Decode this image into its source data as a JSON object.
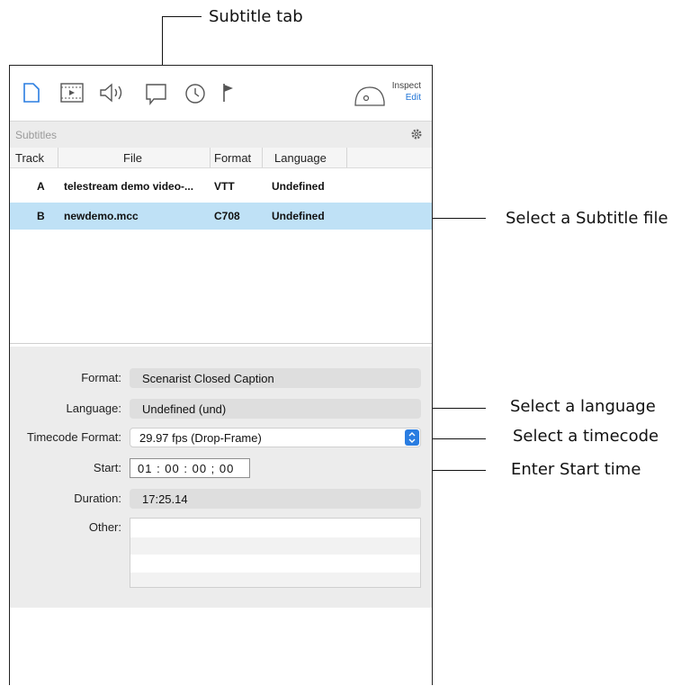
{
  "callouts": {
    "subtitle_tab": "Subtitle tab",
    "select_subtitle_file": "Select a Subtitle file",
    "select_language": "Select a language",
    "select_timecode": "Select a timecode",
    "enter_start_time": "Enter Start time"
  },
  "toolbar": {
    "icons": [
      "document-icon",
      "video-icon",
      "audio-icon",
      "subtitle-icon",
      "clock-icon",
      "flag-icon"
    ],
    "inspect_label": "Inspect",
    "edit_label": "Edit"
  },
  "subtitles": {
    "header_title": "Subtitles",
    "columns": [
      "Track",
      "File",
      "Format",
      "Language"
    ],
    "rows": [
      {
        "track": "A",
        "file": "telestream demo video-...",
        "format": "VTT",
        "language": "Undefined"
      },
      {
        "track": "B",
        "file": "newdemo.mcc",
        "format": "C708",
        "language": "Undefined"
      }
    ],
    "selected_row": "B"
  },
  "form": {
    "format_label": "Format:",
    "format_value": "Scenarist Closed Caption",
    "language_label": "Language:",
    "language_value": "Undefined (und)",
    "timecode_label": "Timecode Format:",
    "timecode_value": "29.97 fps (Drop-Frame)",
    "start_label": "Start:",
    "start_value": "01 : 00 : 00 ; 00",
    "duration_label": "Duration:",
    "duration_value": "17:25.14",
    "other_label": "Other:"
  },
  "colors": {
    "accent": "#2a7de1",
    "selection": "#bfe1f6",
    "link": "#1e73d6"
  }
}
